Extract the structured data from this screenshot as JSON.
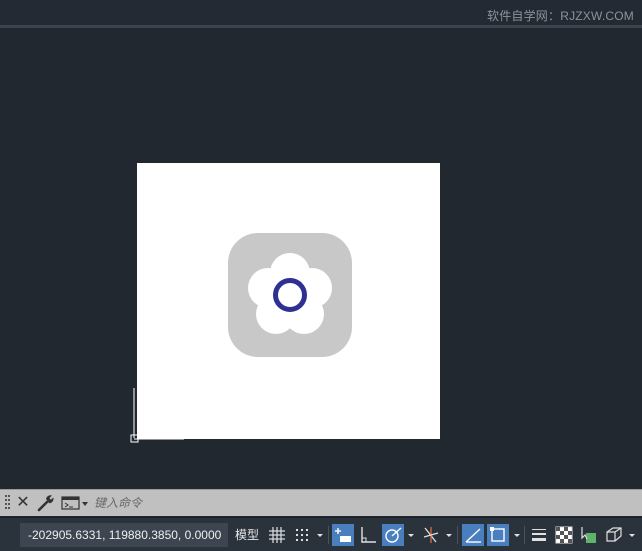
{
  "watermark": {
    "text": "软件自学网：RJZXW.COM"
  },
  "command_line": {
    "close_icon": "close-icon",
    "customize_icon": "wrench-icon",
    "prompt_icon": "command-prompt-icon",
    "placeholder": "键入命令"
  },
  "status_bar": {
    "coordinates": "-202905.6331, 119880.3850, 0.0000",
    "model_label": "模型",
    "buttons": [
      {
        "name": "grid-display",
        "icon": "grid-icon",
        "active": false
      },
      {
        "name": "snap-mode",
        "icon": "snap-dots-icon",
        "active": false
      },
      {
        "name": "dynamic-input",
        "icon": "dynamic-input-icon",
        "active": true
      },
      {
        "name": "ortho-mode",
        "icon": "ortho-icon",
        "active": false
      },
      {
        "name": "polar-tracking",
        "icon": "polar-icon",
        "active": true
      },
      {
        "name": "isodraft",
        "icon": "isodraft-icon",
        "active": false
      },
      {
        "name": "object-snap-tracking",
        "icon": "snap-tracking-icon",
        "active": true
      },
      {
        "name": "object-snap",
        "icon": "object-snap-icon",
        "active": true
      },
      {
        "name": "lineweight",
        "icon": "lineweight-icon",
        "active": false
      },
      {
        "name": "transparency",
        "icon": "transparency-icon",
        "active": false
      },
      {
        "name": "selection-cycling",
        "icon": "selection-cycling-icon",
        "active": false
      },
      {
        "name": "3d-object-snap",
        "icon": "3d-snap-icon",
        "active": false
      }
    ]
  },
  "canvas": {
    "background_color": "#212830",
    "paper_color": "#ffffff",
    "app_icon": {
      "name": "flower-app-icon",
      "tile_color": "#c8c8c8",
      "ring_color": "#2e3192"
    }
  }
}
